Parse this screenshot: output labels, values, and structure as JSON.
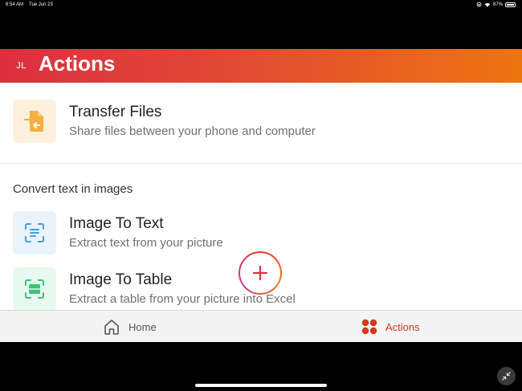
{
  "status_bar": {
    "time": "6:54 AM",
    "date": "Tue Jun 23",
    "battery": "87%",
    "icons": [
      "wifi-icon",
      "screen-rotation-lock-icon",
      "battery-icon"
    ]
  },
  "header": {
    "avatar_initials": "JL",
    "title": "Actions",
    "gradient": [
      "#dc2f3f",
      "#ee7410"
    ]
  },
  "actions": {
    "transfer_files": {
      "title": "Transfer Files",
      "description": "Share files between your phone and computer",
      "icon": "file-transfer-icon",
      "icon_bg": "#fdf1dc",
      "icon_color": "#f5b13d"
    },
    "section_heading": "Convert text in images",
    "image_to_text": {
      "title": "Image To Text",
      "description": "Extract text from your picture",
      "icon": "scan-text-icon",
      "icon_bg": "#e8f3fc",
      "icon_color": "#4a9be0"
    },
    "image_to_table": {
      "title": "Image To Table",
      "description": "Extract a table from your picture into Excel",
      "icon": "scan-table-icon",
      "icon_bg": "#e7f8ee",
      "icon_color": "#3cc47a"
    }
  },
  "bottom_nav": {
    "home_label": "Home",
    "actions_label": "Actions",
    "active": "Actions",
    "active_color": "#d03a1e",
    "fab_icon": "plus-icon"
  }
}
